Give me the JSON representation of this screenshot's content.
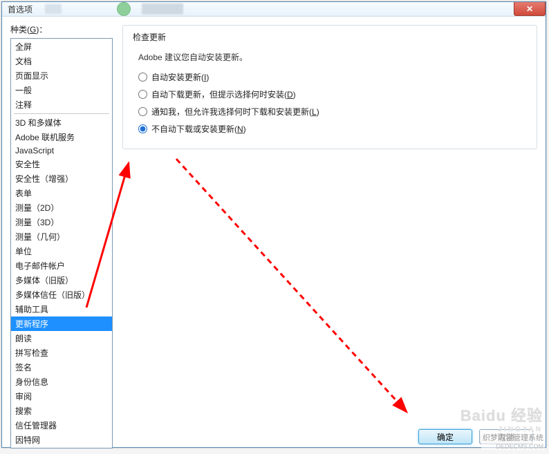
{
  "window": {
    "title": "首选项",
    "close_glyph": "✕"
  },
  "left": {
    "label_pre": "种类(",
    "label_key": "G",
    "label_post": ")：",
    "groups": [
      [
        "全屏",
        "文档",
        "页面显示",
        "一般",
        "注释"
      ],
      [
        "3D 和多媒体",
        "Adobe 联机服务",
        "JavaScript",
        "安全性",
        "安全性（增强）",
        "表单",
        "测量（2D）",
        "测量（3D）",
        "测量（几何）",
        "单位",
        "电子邮件帐户",
        "多媒体（旧版）",
        "多媒体信任（旧版）",
        "辅助工具",
        "更新程序",
        "朗读",
        "拼写检查",
        "签名",
        "身份信息",
        "审阅",
        "搜索",
        "信任管理器",
        "因特网"
      ]
    ],
    "selected": "更新程序"
  },
  "right": {
    "group_title": "检查更新",
    "advice": "Adobe 建议您自动安装更新。",
    "options": [
      {
        "label": "自动安装更新(",
        "key": "I",
        "tail": ")"
      },
      {
        "label": "自动下载更新，但提示选择何时安装(",
        "key": "D",
        "tail": ")"
      },
      {
        "label": "通知我，但允许我选择何时下载和安装更新(",
        "key": "L",
        "tail": ")"
      },
      {
        "label": "不自动下载或安装更新(",
        "key": "N",
        "tail": ")"
      }
    ],
    "selected_index": 3
  },
  "buttons": {
    "ok": "确定",
    "cancel": "取消"
  },
  "watermark": {
    "line1": "Baidu 经验",
    "line2": "JINGYAN"
  },
  "footer": {
    "line1": "织梦内容管理系统",
    "line2": "DEDECMS.COM"
  }
}
